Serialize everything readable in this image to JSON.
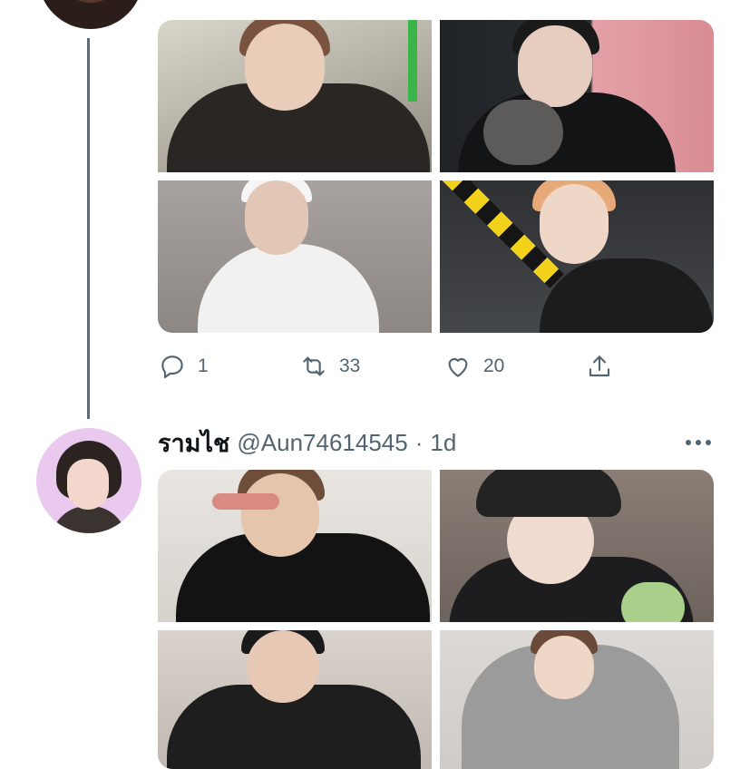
{
  "thread": {
    "top_tweet": {
      "actions": {
        "reply_count": "1",
        "retweet_count": "33",
        "like_count": "20"
      },
      "media": [
        "photo-1",
        "photo-2",
        "photo-3",
        "photo-4"
      ]
    },
    "second_tweet": {
      "display_name": "รามไช",
      "handle": "@Aun74614545",
      "separator": "·",
      "time": "1d",
      "media": [
        "photo-1",
        "photo-2",
        "photo-3",
        "photo-4"
      ]
    }
  },
  "icons": {
    "reply": "reply-icon",
    "retweet": "retweet-icon",
    "like": "heart-icon",
    "share": "share-icon",
    "more": "more-icon"
  },
  "colors": {
    "text_primary": "#0f1419",
    "text_secondary": "#536471",
    "thread_line": "#5f6b75"
  }
}
